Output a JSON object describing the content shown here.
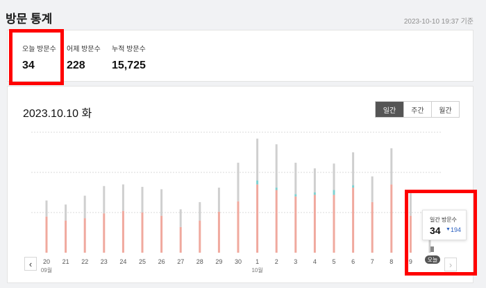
{
  "page": {
    "title": "방문 통계",
    "timestamp": "2023-10-10 19:37 기준"
  },
  "stats": [
    {
      "label": "오늘 방문수",
      "value": "34"
    },
    {
      "label": "어제 방문수",
      "value": "228"
    },
    {
      "label": "누적 방문수",
      "value": "15,725"
    }
  ],
  "chart": {
    "date_title": "2023.10.10 화",
    "period_tabs": [
      {
        "label": "일간",
        "active": true
      },
      {
        "label": "주간",
        "active": false
      },
      {
        "label": "월간",
        "active": false
      }
    ],
    "tooltip": {
      "label": "일간 방문수",
      "value": "34",
      "delta_arrow": "▼",
      "delta": "194"
    },
    "today_badge": "오늘",
    "prev_icon": "chevron-left-icon",
    "next_icon": "chevron-right-icon",
    "month_labels": [
      {
        "label": "09월",
        "at_day": "20"
      },
      {
        "label": "10월",
        "at_day": "1"
      }
    ]
  },
  "colors": {
    "accent_red": "#ff0000",
    "bar_primary": "#f0a99e",
    "bar_secondary": "#cfcfcf",
    "bar_mid": "#7fd1d1",
    "tooltip_blue": "#2a5fbf"
  },
  "chart_data": {
    "type": "bar",
    "stacked": true,
    "categories": [
      "20",
      "21",
      "22",
      "23",
      "24",
      "25",
      "26",
      "27",
      "28",
      "29",
      "30",
      "1",
      "2",
      "3",
      "4",
      "5",
      "6",
      "7",
      "8",
      "9",
      "10"
    ],
    "series": [
      {
        "values": [
          45,
          40,
          43,
          49,
          52,
          50,
          46,
          32,
          40,
          51,
          64,
          85,
          78,
          70,
          72,
          72,
          81,
          63,
          85,
          46,
          0
        ]
      },
      {
        "values": [
          0,
          0,
          0,
          0,
          0,
          0,
          0,
          0,
          0,
          0,
          0,
          5,
          3,
          3,
          3,
          6,
          3,
          0,
          0,
          0,
          0
        ]
      },
      {
        "values": [
          20,
          20,
          28,
          34,
          33,
          32,
          33,
          22,
          23,
          30,
          48,
          52,
          54,
          39,
          30,
          33,
          41,
          32,
          45,
          28,
          34
        ]
      }
    ],
    "grid": true
  }
}
